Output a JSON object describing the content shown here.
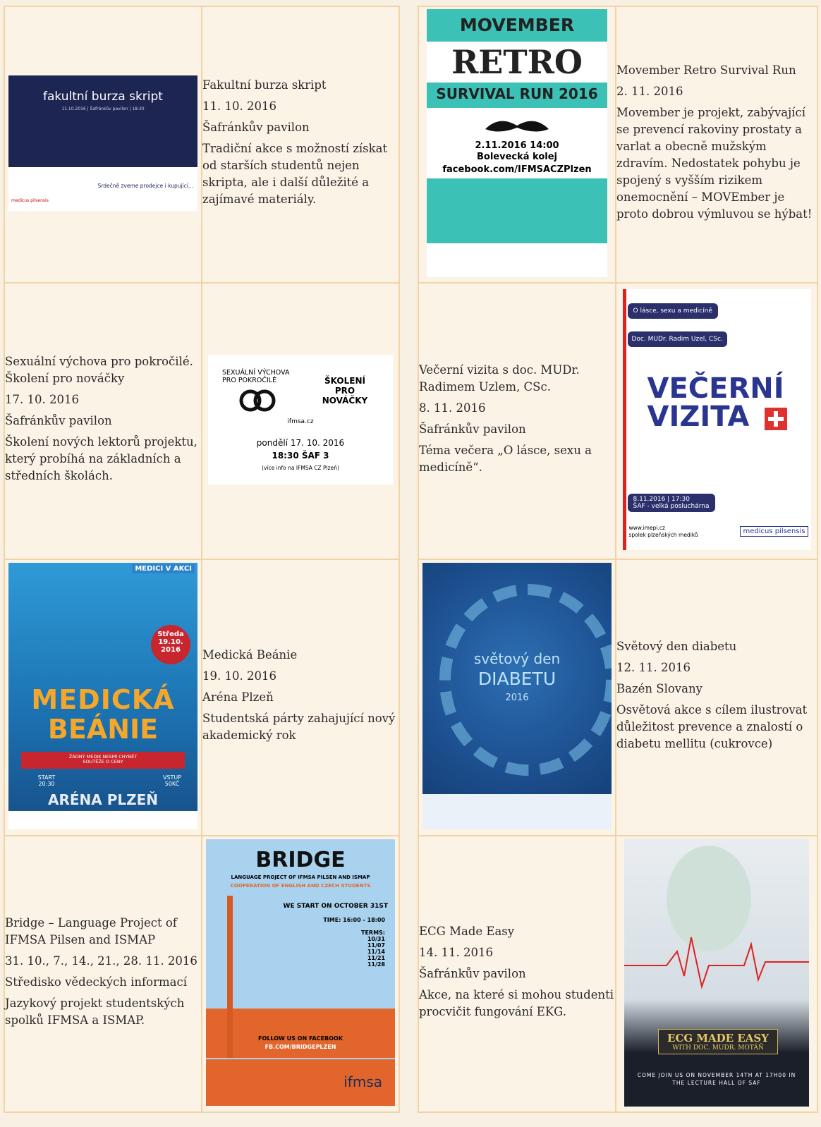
{
  "events": [
    {
      "title": "Fakultní burza skript",
      "date": "11. 10. 2016",
      "place": "Šafránkův pavilon",
      "desc": "Tradiční akce s možností získat od starších studentů nejen skripta, ale i další důležité a zajímavé materiály."
    },
    {
      "title": "Movember Retro Survival Run",
      "date": "2. 11. 2016",
      "place": "",
      "desc": "Movember je projekt, zabývající se prevencí rakoviny prostaty a varlat a obecně mužským zdravím. Nedostatek pohybu je spojený s vyšším rizikem onemocnění – MOVEmber je proto dobrou výmluvou se hýbat!"
    },
    {
      "title": "Sexuální výchova pro pokročilé. Školení pro nováčky",
      "date": "17. 10. 2016",
      "place": "Šafránkův pavilon",
      "desc": "Školení nových lektorů projektu, který probíhá na základních a středních školách."
    },
    {
      "title": "Večerní vizita s doc. MUDr. Radimem Uzlem, CSc.",
      "date": "8. 11. 2016",
      "place": "Šafránkův pavilon",
      "desc": "Téma večera „O lásce, sexu a medicíně“."
    },
    {
      "title": "Medická Beánie",
      "date": "19. 10. 2016",
      "place": "Aréna Plzeň",
      "desc": "Studentská párty zahajující nový akademický rok"
    },
    {
      "title": "Světový den diabetu",
      "date": "12. 11. 2016",
      "place": "Bazén Slovany",
      "desc": "Osvětová akce s cílem ilustrovat důležitost prevence a znalostí o diabetu mellitu (cukrovce)"
    },
    {
      "title": "Bridge – Language Project of IFMSA Pilsen and ISMAP",
      "date": "31. 10., 7., 14., 21., 28. 11. 2016",
      "place": "Středisko vědeckých informací",
      "desc": "Jazykový projekt studentských spolků IFMSA a ISMAP."
    },
    {
      "title": "ECG Made Easy",
      "date": "14. 11. 2016",
      "place": "Šafránkův pavilon",
      "desc": "Akce, na které si mohou studenti procvičit fungování EKG."
    }
  ],
  "posters": {
    "burza": {
      "title": "fakultní burza skript",
      "sub": "11.10.2016 | Šafránkův pavilon | 18:30",
      "tag": "Srdečně zveme prodejce i kupující...",
      "logo": "medicus pilsensis"
    },
    "movember": {
      "l1": "MOVEMBER",
      "l2": "RETRO",
      "l3": "SURVIVAL RUN 2016",
      "l4": "2.11.2016 14:00",
      "l5": "Bolevecká kolej",
      "l6": "facebook.com/IFMSACZPlzen"
    },
    "sexvych": {
      "l1": "SEXUÁLNÍ VÝCHOVA PRO POKROČILÉ",
      "l2": "ŠKOLENÍ PRO NOVÁČKY",
      "l3": "ifmsa.cz",
      "l4": "pondělí 17. 10. 2016",
      "l5": "18:30 ŠAF 3",
      "l6": "(více info na IFMSA CZ Plzeň)"
    },
    "vizita": {
      "t1": "O lásce, sexu a medicíně",
      "t2": "Doc. MUDr. Radim Uzel, CSc.",
      "t3": "VEČERNÍ",
      "t4": "VIZITA",
      "t5": "8.11.2016 | 17:30",
      "t6": "ŠAF - velká posluchárna",
      "t7": "www.imepi.cz",
      "t8": "spolek plzeňských mediků",
      "t9": "medicus pilsensis"
    },
    "beanie": {
      "l1": "MEDICI V AKCI",
      "l2": "MEDICKÁ",
      "l3": "BEÁNIE",
      "l4": "ŽÁDNÝ MEDIK NESMÍ CHYBĚT",
      "l5": "SOUTĚŽE O CENY",
      "l6": "ARÉNA PLZEŇ",
      "l7": "Středa 19.10. 2016",
      "l8": "START 20:30",
      "l9": "VSTUP 50KČ"
    },
    "diabetes": {
      "l1": "světový den",
      "l2": "DIABETU",
      "l3": "2016"
    },
    "bridge": {
      "l1": "BRIDGE",
      "l2": "LANGUAGE PROJECT OF IFMSA PILSEN AND ISMAP",
      "l3": "COOPERATION OF ENGLISH AND CZECH STUDENTS",
      "l4": "WE START ON OCTOBER 31ST",
      "l5": "TIME: 16:00 - 18:00",
      "l6": "TERMS: 10/31 11/07 11/14 11/21 11/28",
      "l7": "FOLLOW US ON FACEBOOK",
      "l8": "FB.COM/BRIDGEPLZEN",
      "l9": "ifmsa"
    },
    "ecg": {
      "l1": "ECG MADE EASY",
      "l2": "WITH DOC. MUDR. MOTÁŇ",
      "l3": "COME JOIN US ON NOVEMBER 14TH AT 17H00 IN THE LECTURE HALL OF SAF"
    }
  }
}
